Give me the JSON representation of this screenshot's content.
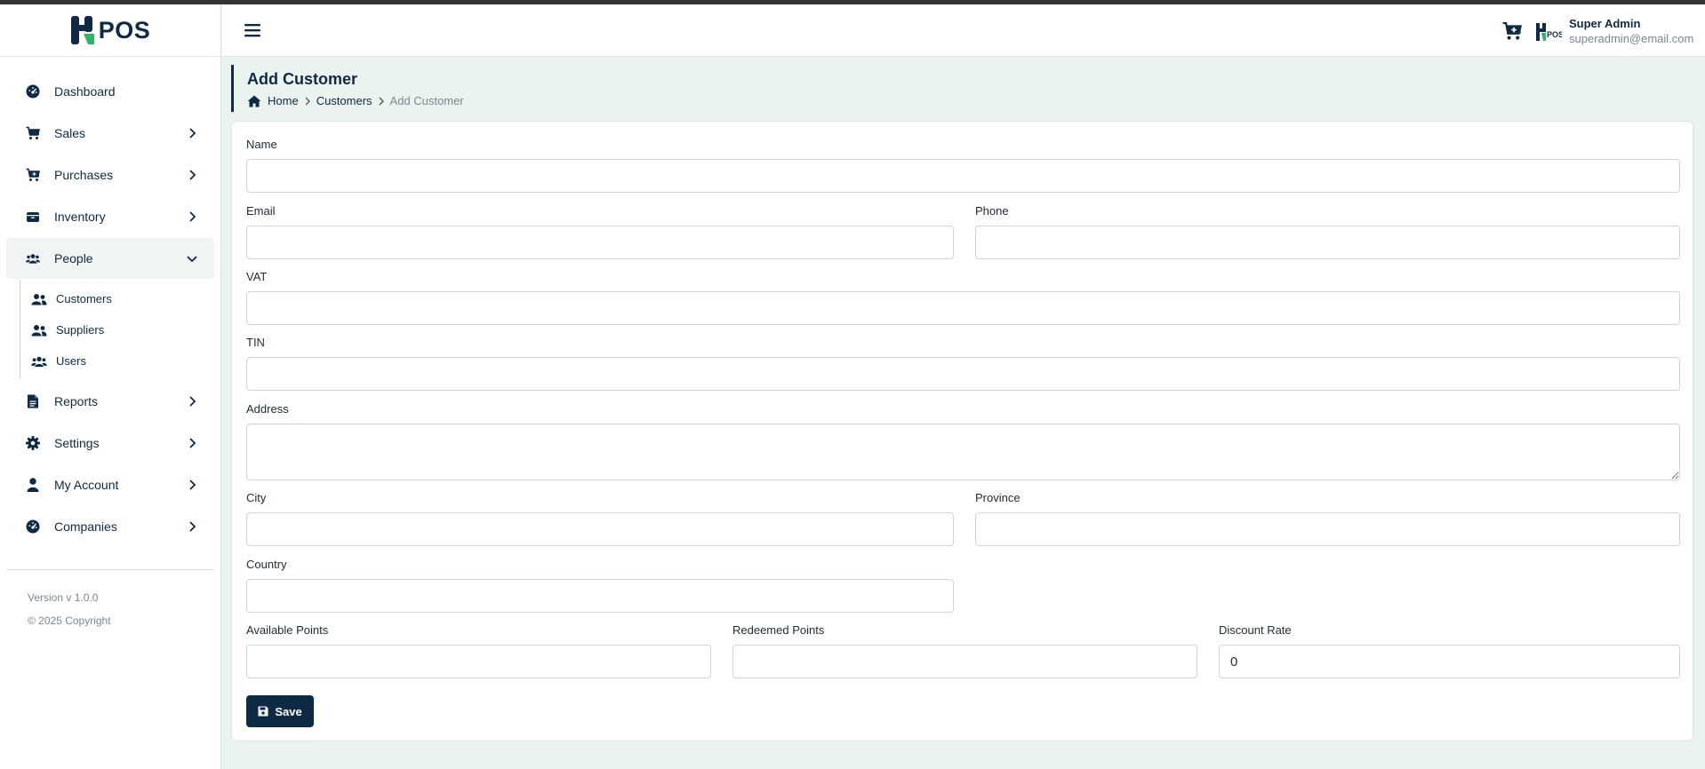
{
  "app": {
    "logo_text": "POS"
  },
  "sidebar": {
    "items": [
      {
        "label": "Dashboard"
      },
      {
        "label": "Sales"
      },
      {
        "label": "Purchases"
      },
      {
        "label": "Inventory"
      },
      {
        "label": "People",
        "expanded": true,
        "children": [
          {
            "label": "Customers"
          },
          {
            "label": "Suppliers"
          },
          {
            "label": "Users"
          }
        ]
      },
      {
        "label": "Reports"
      },
      {
        "label": "Settings"
      },
      {
        "label": "My Account"
      },
      {
        "label": "Companies"
      }
    ],
    "version": "Version v 1.0.0",
    "copyright": "© 2025 Copyright"
  },
  "header": {
    "user_name": "Super Admin",
    "user_email": "superadmin@email.com",
    "avatar_text": "POS"
  },
  "page": {
    "title": "Add Customer",
    "breadcrumb": {
      "home": "Home",
      "section": "Customers",
      "current": "Add Customer"
    }
  },
  "form": {
    "name": {
      "label": "Name",
      "value": ""
    },
    "email": {
      "label": "Email",
      "value": ""
    },
    "phone": {
      "label": "Phone",
      "value": ""
    },
    "vat": {
      "label": "VAT",
      "value": ""
    },
    "tin": {
      "label": "TIN",
      "value": ""
    },
    "address": {
      "label": "Address",
      "value": ""
    },
    "city": {
      "label": "City",
      "value": ""
    },
    "province": {
      "label": "Province",
      "value": ""
    },
    "country": {
      "label": "Country",
      "value": ""
    },
    "available_points": {
      "label": "Available Points",
      "value": ""
    },
    "redeemed_points": {
      "label": "Redeemed Points",
      "value": ""
    },
    "discount_rate": {
      "label": "Discount Rate",
      "value": "0"
    },
    "save_label": "Save"
  },
  "colors": {
    "primary": "#0e2a45",
    "accent_green": "#2fb46a",
    "page_bg": "#eaf3ee"
  }
}
